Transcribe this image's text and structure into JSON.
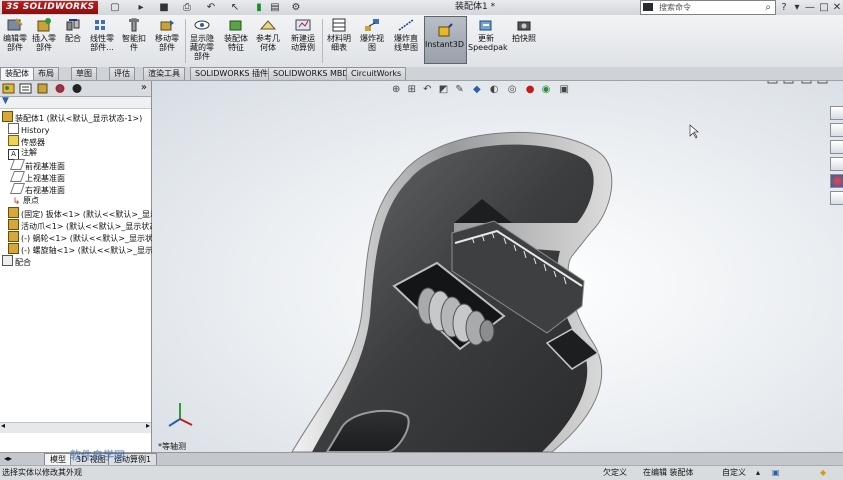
{
  "titlebar": {
    "logo": "3S SOLIDWORKS",
    "document_title": "装配体1 *",
    "search_placeholder": "搜索命令",
    "help_label": "?",
    "minimize": "—",
    "maximize": "□",
    "close": "✕"
  },
  "commands": [
    {
      "id": "insert-component",
      "label": "编辑零\n部件",
      "icon": "edit-component-icon"
    },
    {
      "id": "insert-parts",
      "label": "插入零\n部件",
      "icon": "insert-component-icon"
    },
    {
      "id": "mate",
      "label": "配合",
      "icon": "mate-icon"
    },
    {
      "id": "linear-pattern",
      "label": "线性零\n部件...",
      "icon": "linear-pattern-icon"
    },
    {
      "id": "smart-fasteners",
      "label": "智能扣\n件",
      "icon": "smart-fastener-icon"
    },
    {
      "id": "move-component",
      "label": "移动零\n部件",
      "icon": "move-component-icon"
    },
    {
      "id": "show-hidden",
      "label": "显示隐\n藏的零\n部件",
      "icon": "show-hidden-icon"
    },
    {
      "id": "assembly-features",
      "label": "装配体\n特征",
      "icon": "assembly-feature-icon"
    },
    {
      "id": "reference-geometry",
      "label": "参考几\n何体",
      "icon": "reference-geometry-icon"
    },
    {
      "id": "new-motion-study",
      "label": "新建运\n动算例",
      "icon": "motion-study-icon"
    },
    {
      "id": "bom",
      "label": "材料明\n细表",
      "icon": "bom-icon"
    },
    {
      "id": "exploded-view",
      "label": "爆炸视\n图",
      "icon": "exploded-view-icon"
    },
    {
      "id": "explode-line",
      "label": "爆炸直\n线草图",
      "icon": "explode-line-icon"
    },
    {
      "id": "instant3d",
      "label": "Instant3D",
      "icon": "instant3d-icon"
    },
    {
      "id": "speedpak",
      "label": "更新\nSpeedpak",
      "icon": "speedpak-icon"
    },
    {
      "id": "snapshot",
      "label": "拍快照",
      "icon": "snapshot-icon"
    }
  ],
  "tabs": [
    "装配体",
    "布局",
    "草图",
    "评估",
    "渲染工具",
    "SOLIDWORKS 插件",
    "SOLIDWORKS MBD",
    "CircuitWorks"
  ],
  "tree": {
    "root": "装配体1 (默认<默认_显示状态-1>)",
    "items": [
      {
        "label": "History",
        "icon": "history-icon"
      },
      {
        "label": "传感器",
        "icon": "sensor-icon"
      },
      {
        "label": "注解",
        "icon": "annotation-icon"
      },
      {
        "label": "前视基准面",
        "icon": "plane-icon"
      },
      {
        "label": "上视基准面",
        "icon": "plane-icon"
      },
      {
        "label": "右视基准面",
        "icon": "plane-icon"
      },
      {
        "label": "原点",
        "icon": "origin-icon"
      },
      {
        "label": "(固定) 扳体<1> (默认<<默认>_显示",
        "icon": "part-icon"
      },
      {
        "label": "活动爪<1> (默认<<默认>_显示状态",
        "icon": "part-icon"
      },
      {
        "label": "(-) 蜗轮<1> (默认<<默认>_显示状",
        "icon": "part-icon"
      },
      {
        "label": "(-) 螺旋轴<1> (默认<<默认>_显示",
        "icon": "part-icon"
      },
      {
        "label": "配合",
        "icon": "mates-folder-icon"
      }
    ]
  },
  "viewport": {
    "view_label": "*等轴测"
  },
  "bottom_tabs": [
    "模型",
    "3D 视图",
    "运动算例1"
  ],
  "watermark": "软件自学网",
  "status": {
    "hint": "选择实体以修改其外观",
    "constraint": "欠定义",
    "mode": "在编辑 装配体",
    "custom": "自定义"
  },
  "colors": {
    "logo_red": "#b01818",
    "accent": "#2b5fa8"
  }
}
